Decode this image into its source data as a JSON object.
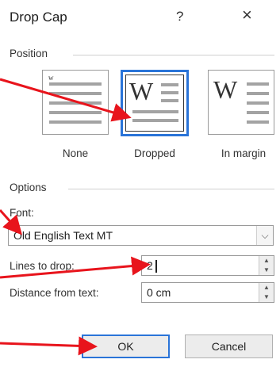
{
  "dialog": {
    "title": "Drop Cap",
    "help_label": "?",
    "close_label": "×"
  },
  "position": {
    "group_label": "Position",
    "options": [
      {
        "label": "None",
        "selected": false
      },
      {
        "label": "Dropped",
        "selected": true
      },
      {
        "label": "In margin",
        "selected": false
      }
    ],
    "tile_glyph": "W",
    "tile_glyph_small": "w"
  },
  "options": {
    "group_label": "Options",
    "font_label": "Font:",
    "font_value": "Old English Text MT",
    "lines_label": "Lines to drop:",
    "lines_value": "2",
    "distance_label": "Distance from text:",
    "distance_value": "0 cm"
  },
  "buttons": {
    "ok": "OK",
    "cancel": "Cancel"
  },
  "colors": {
    "accent": "#2a74d8",
    "annotation_arrow": "#e8141c"
  },
  "icons": {
    "spin_up": "▲",
    "spin_down": "▼",
    "dropdown": "⌵"
  }
}
